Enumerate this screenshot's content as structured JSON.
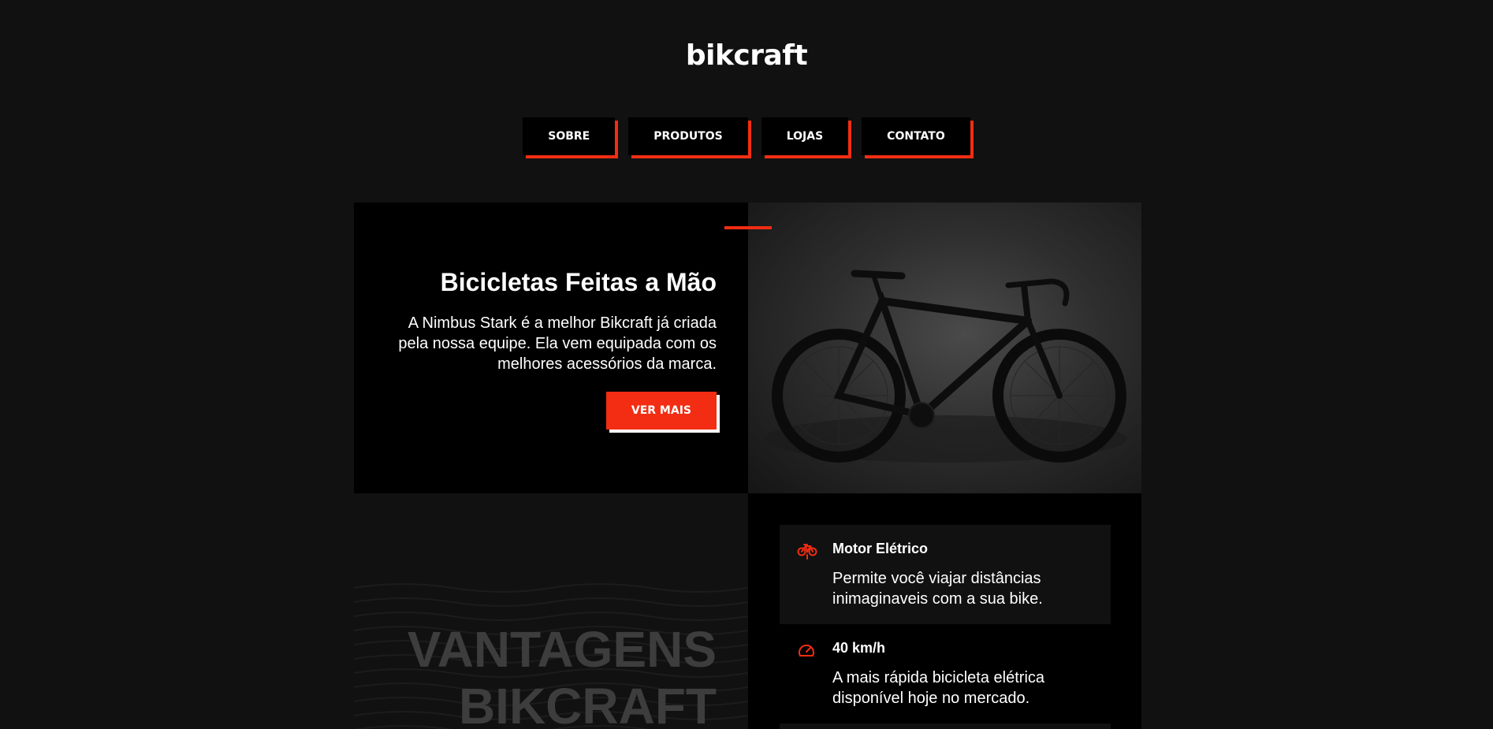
{
  "logo": "bikcraft",
  "nav": {
    "items": [
      "SOBRE",
      "PRODUTOS",
      "LOJAS",
      "CONTATO"
    ]
  },
  "hero": {
    "title": "Bicicletas Feitas a Mão",
    "description": "A Nimbus Stark é a melhor Bikcraft já criada pela nossa equipe. Ela vem equipada com os melhores acessórios da marca.",
    "button_label": "VER MAIS",
    "image": "bicycle-photo"
  },
  "advantages": {
    "title_line1": "VANTAGENS",
    "title_line2": "BIKCRAFT",
    "items": [
      {
        "icon": "electric-bike-icon",
        "title": "Motor Elétrico",
        "description": "Permite você viajar distâncias inimaginaveis com a sua bike."
      },
      {
        "icon": "speedometer-icon",
        "title": "40 km/h",
        "description": "A mais rápida bicicleta elétrica disponível hoje no mercado."
      }
    ]
  },
  "colors": {
    "background": "#111111",
    "panel": "#000000",
    "accent": "#f22d13",
    "text": "#ffffff",
    "muted_title": "#3d3d3d"
  }
}
